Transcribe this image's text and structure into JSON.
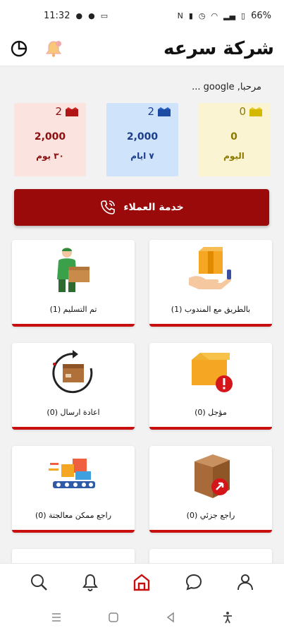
{
  "status_bar": {
    "time": "11:32",
    "battery": "66%"
  },
  "header": {
    "title": "شركة سرعه"
  },
  "welcome": "مرحبا, google ...",
  "stats": [
    {
      "count": "0",
      "value": "0",
      "label": "اليوم",
      "color": "#8a7a00",
      "bg": "#fbf4d3"
    },
    {
      "count": "2",
      "value": "2,000",
      "label": "٧ ايام",
      "color": "#1a3e8c",
      "bg": "#cfe3fb"
    },
    {
      "count": "2",
      "value": "2,000",
      "label": "٣٠ يوم",
      "color": "#8a1010",
      "bg": "#fbe3e0"
    }
  ],
  "support_button": {
    "label": "خدمة العملاء"
  },
  "tiles": [
    {
      "label": "بالطريق مع المندوب (1)",
      "icon": "hand-box-icon"
    },
    {
      "label": "تم التسليم (1)",
      "icon": "courier-delivery-icon"
    },
    {
      "label": "مؤجل (0)",
      "icon": "postponed-box-icon"
    },
    {
      "label": "اعادة ارسال (0)",
      "icon": "resend-box-icon"
    },
    {
      "label": "راجع جزئي (0)",
      "icon": "partial-return-icon"
    },
    {
      "label": "راجع ممكن معالجتة (0)",
      "icon": "conveyor-icon"
    }
  ],
  "bottom_nav": [
    "search-icon",
    "bell-icon",
    "home-icon",
    "chat-icon",
    "profile-icon"
  ],
  "colors": {
    "brand": "#9b0a0a",
    "accent": "#c70f0f"
  }
}
